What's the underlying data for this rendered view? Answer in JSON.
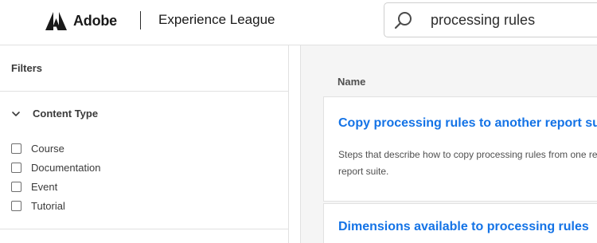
{
  "header": {
    "brand_name": "Adobe",
    "site_name": "Experience League",
    "search": {
      "value": "processing rules",
      "icon": "search-icon"
    }
  },
  "sidebar": {
    "title": "Filters",
    "content_type": {
      "label": "Content Type",
      "expanded": true,
      "options": [
        {
          "label": "Course",
          "checked": false
        },
        {
          "label": "Documentation",
          "checked": false
        },
        {
          "label": "Event",
          "checked": false
        },
        {
          "label": "Tutorial",
          "checked": false
        }
      ]
    }
  },
  "results": {
    "column_header": "Name",
    "items": [
      {
        "title": "Copy processing rules to another report suite",
        "desc_line1": "Steps that describe how to copy processing rules from one report suite to another",
        "desc_line2": "report suite."
      },
      {
        "title": "Dimensions available to processing rules"
      }
    ]
  },
  "colors": {
    "link": "#1473e6",
    "border": "#e1e1e1",
    "panel_bg": "#f5f5f5"
  }
}
